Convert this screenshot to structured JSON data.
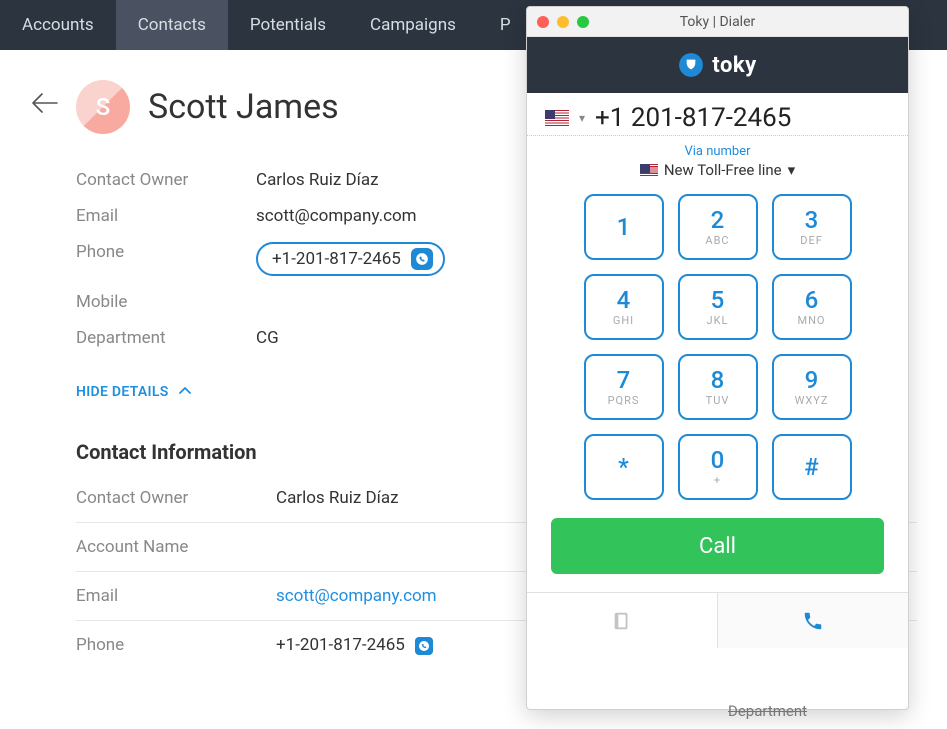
{
  "topnav": {
    "tabs": [
      "Accounts",
      "Contacts",
      "Potentials",
      "Campaigns",
      "P"
    ],
    "activeIndex": 1
  },
  "contact": {
    "initial": "S",
    "name": "Scott James",
    "fields": {
      "owner_label": "Contact Owner",
      "owner_value": "Carlos Ruiz Díaz",
      "email_label": "Email",
      "email_value": "scott@company.com",
      "phone_label": "Phone",
      "phone_value": "+1-201-817-2465",
      "mobile_label": "Mobile",
      "mobile_value": "",
      "department_label": "Department",
      "department_value": "CG"
    },
    "hide_details": "HIDE DETAILS",
    "info_title": "Contact Information",
    "info": {
      "owner_label": "Contact Owner",
      "owner_value": "Carlos Ruiz Díaz",
      "account_label": "Account Name",
      "account_value": "",
      "email_label": "Email",
      "email_value": "scott@company.com",
      "phone_label": "Phone",
      "phone_value": "+1-201-817-2465"
    }
  },
  "dialer": {
    "window_title": "Toky | Dialer",
    "brand": "toky",
    "number": "+1 201-817-2465",
    "via_label": "Via number",
    "via_line": "New Toll-Free line",
    "keys": [
      {
        "num": "1",
        "letters": ""
      },
      {
        "num": "2",
        "letters": "ABC"
      },
      {
        "num": "3",
        "letters": "DEF"
      },
      {
        "num": "4",
        "letters": "GHI"
      },
      {
        "num": "5",
        "letters": "JKL"
      },
      {
        "num": "6",
        "letters": "MNO"
      },
      {
        "num": "7",
        "letters": "PQRS"
      },
      {
        "num": "8",
        "letters": "TUV"
      },
      {
        "num": "9",
        "letters": "WXYZ"
      },
      {
        "num": "*",
        "letters": ""
      },
      {
        "num": "0",
        "letters": "+"
      },
      {
        "num": "#",
        "letters": ""
      }
    ],
    "call_label": "Call"
  },
  "shadow_text": "Department"
}
